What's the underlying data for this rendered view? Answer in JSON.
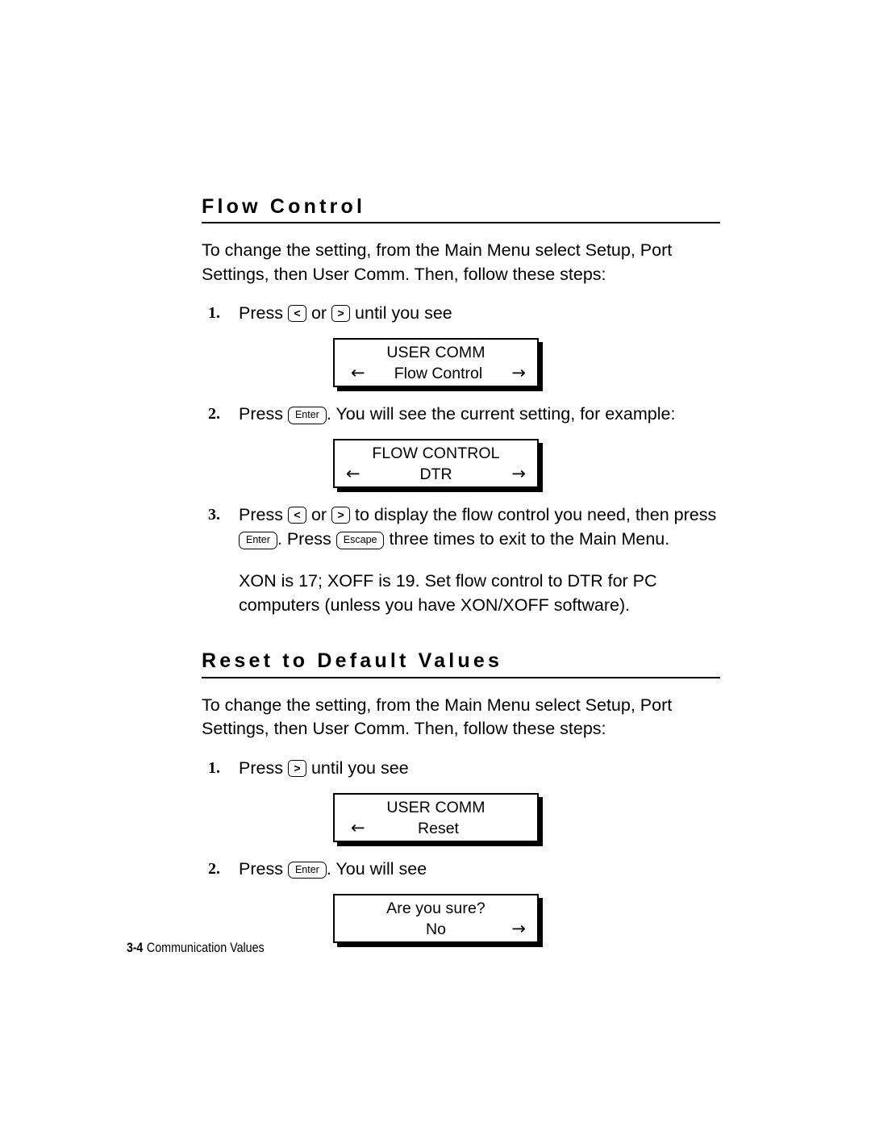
{
  "document": {
    "footer": {
      "page_number": "3-4",
      "chapter_title": "Communication Values"
    }
  },
  "sections": [
    {
      "heading": "Flow Control",
      "intro": "To change the setting, from the Main Menu select Setup, Port Settings, then User Comm.  Then, follow these steps:",
      "steps": [
        {
          "number": "1.",
          "text_before": "Press",
          "key1": "<",
          "text_mid": "or",
          "key2": ">",
          "text_after": "until you see"
        },
        {
          "number": "2.",
          "text_before": "Press",
          "key1": "Enter",
          "text_after": ".  You will see the current setting, for example:"
        },
        {
          "number": "3.",
          "text_before": "Press",
          "key1": "<",
          "text_mid": "or",
          "key2": ">",
          "text_after": "to display the flow control you need, then press",
          "key3": "Enter",
          "text_after2": ".  Press",
          "key4": "Escape",
          "text_after3": "three times to exit to the Main Menu."
        }
      ],
      "note": "XON is 17; XOFF is 19.  Set flow control to DTR for PC computers (unless you have XON/XOFF software).",
      "displays": [
        {
          "line1": "USER COMM",
          "line2": "Flow Control",
          "arrow_left": "←",
          "arrow_right": "→",
          "show_left": true,
          "show_right": true
        },
        {
          "line1": "FLOW CONTROL",
          "line2": "DTR",
          "arrow_left": "←",
          "arrow_right": "→",
          "show_left": true,
          "show_right": true
        }
      ]
    },
    {
      "heading": "Reset to Default Values",
      "intro": "To change the setting, from the Main Menu select Setup, Port Settings, then User Comm.  Then, follow these steps:",
      "steps": [
        {
          "number": "1.",
          "text_before": "Press",
          "key1": ">",
          "text_after": "until you see"
        },
        {
          "number": "2.",
          "text_before": "Press",
          "key1": "Enter",
          "text_after": ".  You will see"
        }
      ],
      "displays": [
        {
          "line1": "USER COMM",
          "line2": "Reset",
          "arrow_left": "←",
          "arrow_right": "→",
          "show_left": true,
          "show_right": false
        },
        {
          "line1": "Are you sure?",
          "line2": "No",
          "arrow_left": "←",
          "arrow_right": "→",
          "show_left": false,
          "show_right": true
        }
      ]
    }
  ]
}
